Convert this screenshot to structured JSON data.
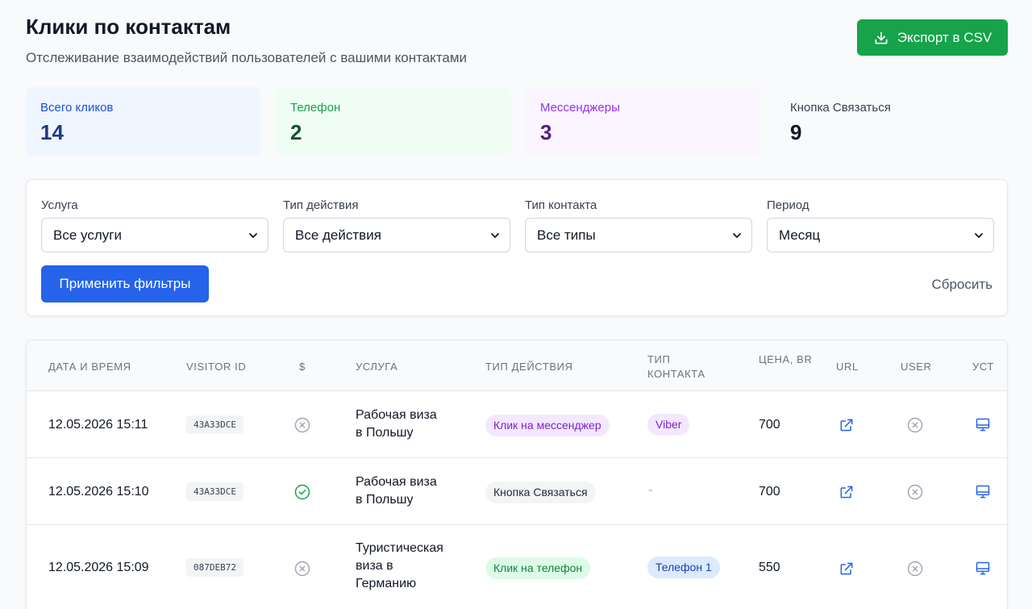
{
  "header": {
    "title": "Клики по контактам",
    "subtitle": "Отслеживание взаимодействий пользователей с вашими контактами",
    "export_label": "Экспорт в CSV"
  },
  "stats": [
    {
      "label": "Всего кликов",
      "value": "14"
    },
    {
      "label": "Телефон",
      "value": "2"
    },
    {
      "label": "Мессенджеры",
      "value": "3"
    },
    {
      "label": "Кнопка Связаться",
      "value": "9"
    }
  ],
  "filters": {
    "service": {
      "label": "Услуга",
      "value": "Все услуги"
    },
    "action": {
      "label": "Тип действия",
      "value": "Все действия"
    },
    "contact": {
      "label": "Тип контакта",
      "value": "Все типы"
    },
    "period": {
      "label": "Период",
      "value": "Месяц"
    },
    "apply_label": "Применить фильтры",
    "reset_label": "Сбросить"
  },
  "table": {
    "columns": [
      "Дата и время",
      "Visitor ID",
      "$",
      "Услуга",
      "Тип действия",
      "Тип контакта",
      "Цена, BR",
      "URL",
      "User",
      "Уст"
    ],
    "rows": [
      {
        "datetime": "12.05.2026 15:11",
        "visitor_id": "43A33DCE",
        "paid": false,
        "service_line1": "Рабочая виза",
        "service_line2": "в Польшу",
        "service_line3": "",
        "action": "Клик на мессенджер",
        "action_kind": "messenger",
        "contact": "Viber",
        "contact_kind": "viber",
        "price": "700"
      },
      {
        "datetime": "12.05.2026 15:10",
        "visitor_id": "43A33DCE",
        "paid": true,
        "service_line1": "Рабочая виза",
        "service_line2": "в Польшу",
        "service_line3": "",
        "action": "Кнопка Связаться",
        "action_kind": "contact",
        "contact": "-",
        "contact_kind": "none",
        "price": "700"
      },
      {
        "datetime": "12.05.2026 15:09",
        "visitor_id": "087DEB72",
        "paid": false,
        "service_line1": "Туристическая",
        "service_line2": "виза в",
        "service_line3": "Германию",
        "action": "Клик на телефон",
        "action_kind": "phone",
        "contact": "Телефон 1",
        "contact_kind": "phone",
        "price": "550"
      }
    ]
  },
  "colors": {
    "export_green": "#16a34a",
    "apply_blue": "#2563eb",
    "messenger_badge_bg": "#f3e8ff",
    "messenger_badge_fg": "#7e22ce",
    "phone_badge_bg": "#dcfce7",
    "phone_badge_fg": "#15803d",
    "contact_badge_bg": "#f3f4f6",
    "contact_badge_fg": "#1f2937",
    "phone_contact_bg": "#dbeafe",
    "phone_contact_fg": "#1e40af"
  },
  "icons": {
    "export": "download-icon",
    "paid_yes": "check-circle-icon",
    "paid_no": "x-circle-icon",
    "url": "external-link-icon",
    "user": "x-circle-icon",
    "device": "desktop-icon",
    "select": "chevron-down-icon"
  }
}
